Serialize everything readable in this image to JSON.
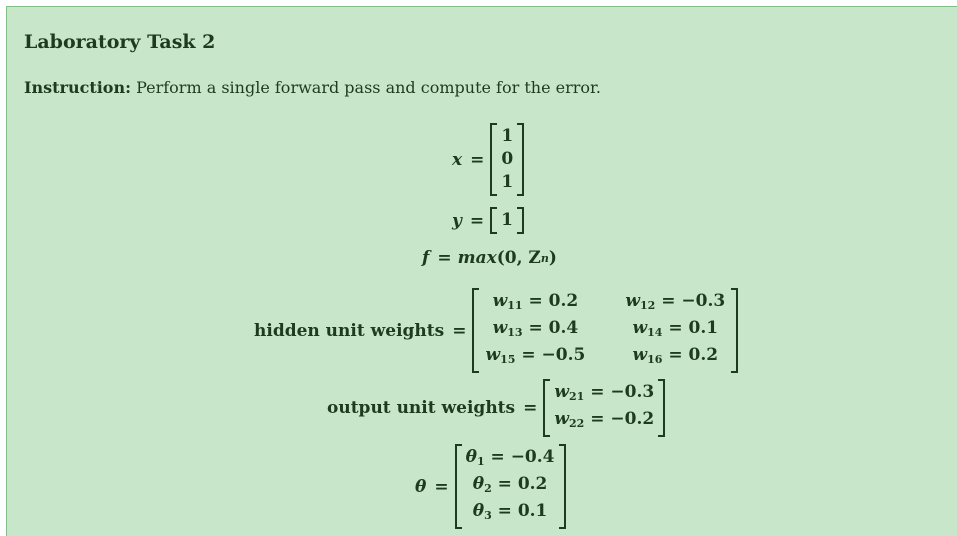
{
  "title": "Laboratory Task 2",
  "instruction": {
    "label": "Instruction:",
    "text": " Perform a single forward pass and compute for the error."
  },
  "x_vector": {
    "lhs": "x",
    "eq": "=",
    "values": [
      "1",
      "0",
      "1"
    ]
  },
  "y_vector": {
    "lhs": "y",
    "eq": "=",
    "values": [
      "1"
    ]
  },
  "activation": {
    "lhs": "f",
    "eq": "=",
    "func": "max",
    "args": "(0, Z",
    "arg_sub": "n",
    "close": ")"
  },
  "hidden_weights": {
    "label": "hidden unit weights",
    "eq": "=",
    "rows": [
      [
        {
          "sym": "w",
          "sub": "11",
          "val": "0.2"
        },
        {
          "sym": "w",
          "sub": "12",
          "val": "−0.3"
        }
      ],
      [
        {
          "sym": "w",
          "sub": "13",
          "val": "0.4"
        },
        {
          "sym": "w",
          "sub": "14",
          "val": "0.1"
        }
      ],
      [
        {
          "sym": "w",
          "sub": "15",
          "val": "−0.5"
        },
        {
          "sym": "w",
          "sub": "16",
          "val": "0.2"
        }
      ]
    ]
  },
  "output_weights": {
    "label": "output unit weights",
    "eq": "=",
    "rows": [
      {
        "sym": "w",
        "sub": "21",
        "val": "−0.3"
      },
      {
        "sym": "w",
        "sub": "22",
        "val": "−0.2"
      }
    ]
  },
  "theta": {
    "lhs": "θ",
    "eq": "=",
    "rows": [
      {
        "sym": "θ",
        "sub": "1",
        "val": "−0.4"
      },
      {
        "sym": "θ",
        "sub": "2",
        "val": "0.2"
      },
      {
        "sym": "θ",
        "sub": "3",
        "val": "0.1"
      }
    ]
  },
  "colors": {
    "panel_bg": "#c8e6c9",
    "panel_border": "#7fbf86",
    "text": "#1f3b1f"
  }
}
